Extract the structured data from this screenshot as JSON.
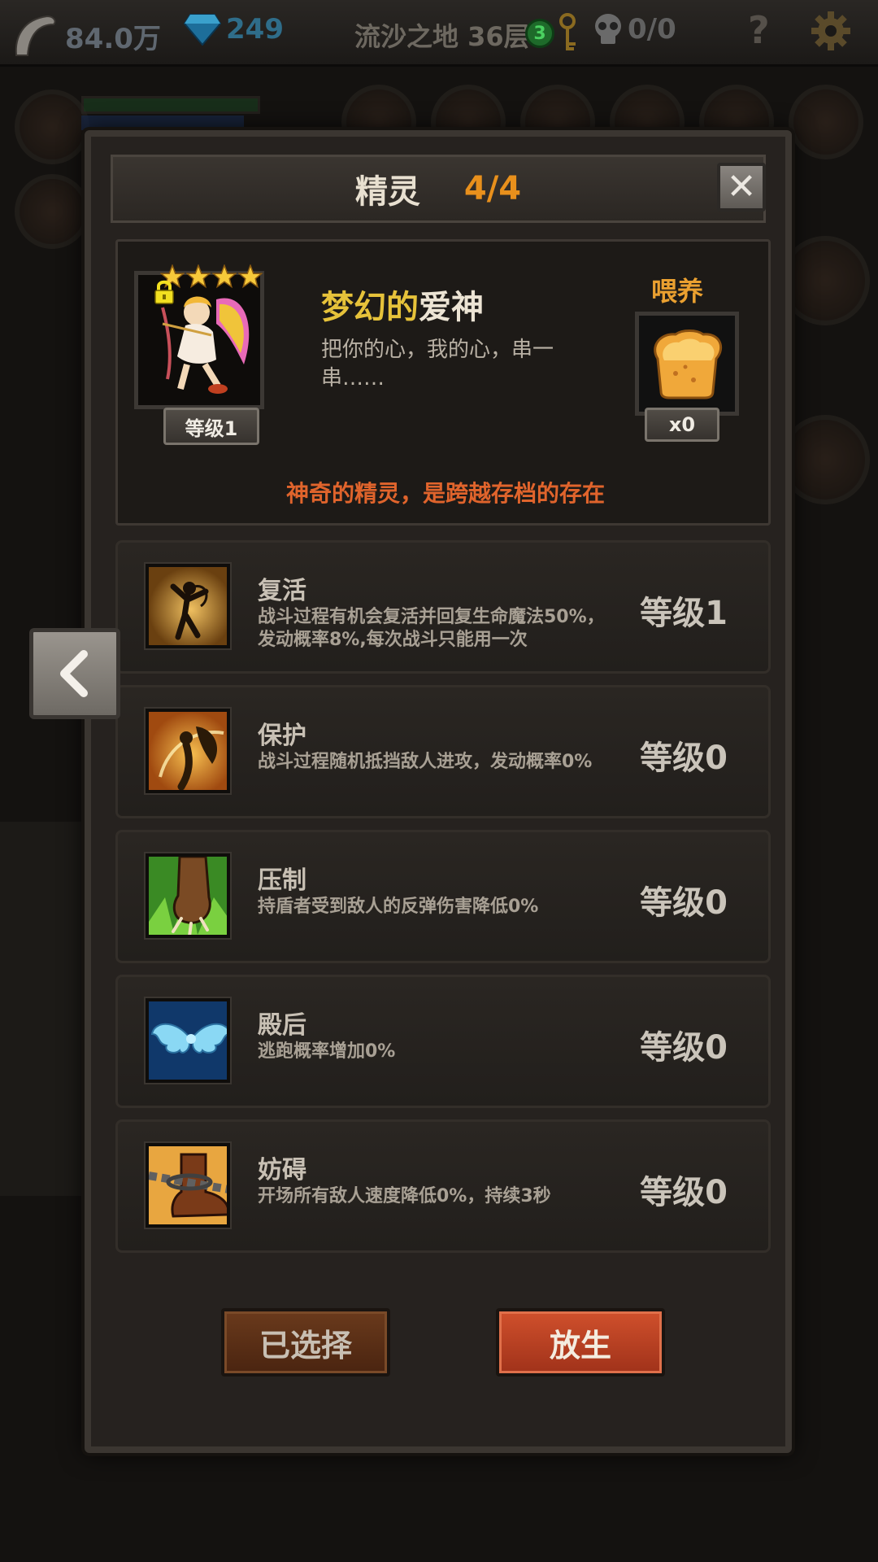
{
  "topbar": {
    "gold": "84.0万",
    "gems": "249",
    "floor": "流沙之地 36层",
    "keys": "3",
    "skulls": "0/0",
    "help": "?"
  },
  "dialog": {
    "title": "精灵",
    "count": "4/4",
    "close": "✕"
  },
  "sprite": {
    "stars": 4,
    "level": "等级1",
    "name_part1": "梦幻的",
    "name_part2": "爱神",
    "description": "把你的心，我的心，串一串……",
    "feed_label": "喂养",
    "food_count": "x0",
    "note": "神奇的精灵，是跨越存档的存在"
  },
  "skills": [
    {
      "name": "复活",
      "desc": "战斗过程有机会复活并回复生命魔法50%，发动概率8%,每次战斗只能用一次",
      "level": "等级1",
      "icon": "dancer-icon"
    },
    {
      "name": "保护",
      "desc": "战斗过程随机抵挡敌人进攻，发动概率0%",
      "level": "等级0",
      "icon": "fairy-shield-icon"
    },
    {
      "name": "压制",
      "desc": "持盾者受到敌人的反弹伤害降低0%",
      "level": "等级0",
      "icon": "claw-icon"
    },
    {
      "name": "殿后",
      "desc": "逃跑概率增加0%",
      "level": "等级0",
      "icon": "wings-icon"
    },
    {
      "name": "妨碍",
      "desc": "开场所有敌人速度降低0%，持续3秒",
      "level": "等级0",
      "icon": "chained-boot-icon"
    }
  ],
  "buttons": {
    "selected": "已选择",
    "release": "放生"
  },
  "colors": {
    "accent_orange": "#e8901c",
    "note_red": "#e0642c",
    "name_gold": "#e6c23a",
    "release_button": "#c0442a"
  }
}
